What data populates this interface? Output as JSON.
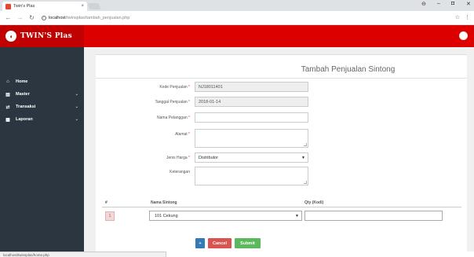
{
  "browser": {
    "tab_title": "Twin's Plas",
    "tab_close": "×",
    "url_host": "localhost",
    "url_path": "/twinsplas/tambah_penjualan.php",
    "status_url": "localhost/twinsplas/home.php",
    "minimize": "–",
    "maximize": "◘",
    "close": "✕"
  },
  "app": {
    "brand_name": "TWIN'S Plas",
    "accent_color": "#dd0000"
  },
  "sidebar": {
    "items": [
      {
        "label": "Home",
        "icon": "home-icon",
        "glyph": "⌂",
        "has_submenu": false
      },
      {
        "label": "Master",
        "icon": "database-icon",
        "glyph": "▤",
        "has_submenu": true
      },
      {
        "label": "Transaksi",
        "icon": "cart-icon",
        "glyph": "⇄",
        "has_submenu": true
      },
      {
        "label": "Laporan",
        "icon": "report-icon",
        "glyph": "▦",
        "has_submenu": true
      }
    ]
  },
  "form": {
    "title": "Tambah Penjualan Sintong",
    "fields": {
      "kode": {
        "label": "Kode Penjualan",
        "value": "NJ18011401"
      },
      "tanggal": {
        "label": "Tanggal Penjualan",
        "value": "2018-01-14"
      },
      "nama": {
        "label": "Nama Pelanggan",
        "value": ""
      },
      "alamat": {
        "label": "Alamat",
        "value": ""
      },
      "jenis_harga": {
        "label": "Jenis Harga",
        "value": "Distributor"
      },
      "keterangan": {
        "label": "Keterangan",
        "value": ""
      }
    },
    "required_mark": "*"
  },
  "items_table": {
    "columns": [
      "#",
      "Nama Sintong",
      "Qty (Kodi)"
    ],
    "rows": [
      {
        "num": "1",
        "product": "101 Cekung",
        "qty": ""
      }
    ]
  },
  "buttons": {
    "add": "+",
    "cancel": "Cancel",
    "submit": "Submit"
  }
}
